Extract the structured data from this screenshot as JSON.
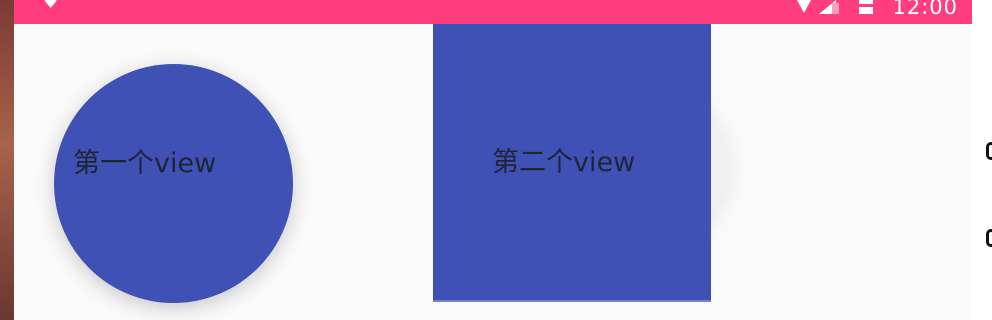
{
  "status_bar": {
    "left_icon": "♥",
    "wifi_icon": "wifi-icon",
    "signal_icon": "signal-icon",
    "battery_icon": "battery-icon",
    "time": "12:00"
  },
  "views": {
    "first_label": "第一个view",
    "second_label": "第二个view"
  },
  "colors": {
    "status_bar": "#ff3d7f",
    "view_blue": "#3f51b5",
    "screen_background": "#fafafa"
  }
}
